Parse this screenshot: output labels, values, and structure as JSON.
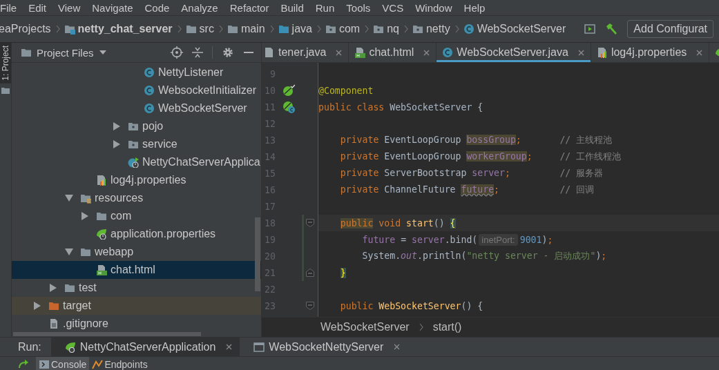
{
  "menu": [
    "File",
    "Edit",
    "View",
    "Navigate",
    "Code",
    "Analyze",
    "Refactor",
    "Build",
    "Run",
    "Tools",
    "VCS",
    "Window",
    "Help"
  ],
  "navbar": {
    "crumbs": [
      {
        "label": "eaProjects",
        "kind": "plain"
      },
      {
        "label": "netty_chat_server",
        "kind": "module"
      },
      {
        "label": "src",
        "kind": "folder"
      },
      {
        "label": "main",
        "kind": "folder"
      },
      {
        "label": "java",
        "kind": "source-folder"
      },
      {
        "label": "com",
        "kind": "package"
      },
      {
        "label": "nq",
        "kind": "package"
      },
      {
        "label": "netty",
        "kind": "package"
      },
      {
        "label": "WebSocketServer",
        "kind": "class"
      }
    ],
    "config_button": "Add Configurat"
  },
  "side_strip": {
    "label": "1: Project",
    "selected": true
  },
  "project": {
    "title": "Project Files",
    "tree": [
      {
        "children": [
          {
            "children": [
              {
                "children": [
                  {
                    "children": [
                      {
                        "children": [
                          {
                            "children": [
                              {
                                "label": "NettyListener",
                                "kind": "class",
                                "selected": false
                              },
                              {
                                "label": "WebsocketInitializer",
                                "kind": "class",
                                "selected": false
                              },
                              {
                                "label": "WebSocketServer",
                                "kind": "class",
                                "selected": false
                              }
                            ]
                          },
                          {
                            "label": "pojo",
                            "kind": "package",
                            "expanded": false,
                            "selected": false
                          },
                          {
                            "label": "service",
                            "kind": "package",
                            "expanded": false,
                            "selected": false
                          },
                          {
                            "label": "NettyChatServerApplica",
                            "kind": "spring-class",
                            "selected": false
                          }
                        ]
                      }
                    ]
                  },
                  {
                    "label": "log4j.properties",
                    "kind": "properties",
                    "selected": false
                  }
                ]
              },
              {
                "label": "resources",
                "kind": "resources-folder",
                "expanded": true,
                "selected": false,
                "children": [
                  {
                    "label": "com",
                    "kind": "folder",
                    "expanded": false,
                    "selected": false
                  },
                  {
                    "label": "application.properties",
                    "kind": "spring-properties",
                    "selected": false
                  }
                ]
              },
              {
                "label": "webapp",
                "kind": "folder",
                "expanded": true,
                "selected": false,
                "children": [
                  {
                    "label": "chat.html",
                    "kind": "html",
                    "selected": true
                  }
                ]
              }
            ]
          },
          {
            "label": "test",
            "kind": "folder",
            "expanded": false,
            "selected": false
          }
        ]
      },
      {
        "label": "target",
        "kind": "excluded-folder",
        "expanded": false,
        "selected": false
      },
      {
        "label": ".gitignore",
        "kind": "file",
        "selected": false
      }
    ]
  },
  "editor": {
    "tabs": [
      {
        "label": "tener.java",
        "kind": "java",
        "selected": false
      },
      {
        "label": "chat.html",
        "kind": "html",
        "selected": false
      },
      {
        "label": "WebSocketServer.java",
        "kind": "class",
        "selected": true
      },
      {
        "label": "log4j.properties",
        "kind": "properties",
        "selected": false
      },
      {
        "kind": "spring",
        "selected": false
      }
    ],
    "lines": [
      {
        "number": "9",
        "current": false,
        "changed": false
      },
      {
        "number": "10",
        "current": false,
        "changed": false,
        "markers": [
          {
            "kind": "bean-check"
          }
        ],
        "tokens": [
          {
            "kind": "annotation",
            "text": "@Component"
          }
        ]
      },
      {
        "number": "11",
        "current": false,
        "changed": false,
        "markers": [
          {
            "kind": "bean-class"
          }
        ],
        "tokens": [
          {
            "kind": "keyword",
            "text": "public class"
          },
          {
            "kind": "plain",
            "text": " WebSocketServer {"
          }
        ]
      },
      {
        "number": "12",
        "current": false,
        "changed": false
      },
      {
        "number": "13",
        "current": false,
        "changed": false,
        "tokens": [
          {
            "kind": "keyword",
            "text": "    private"
          },
          {
            "kind": "plain",
            "text": " EventLoopGroup "
          },
          {
            "kind": "field_marked",
            "text": "bossGroup"
          },
          {
            "kind": "keyword",
            "text": ";"
          },
          {
            "kind": "comment",
            "text": "       // 主线程池"
          }
        ]
      },
      {
        "number": "14",
        "current": false,
        "changed": false,
        "tokens": [
          {
            "kind": "keyword",
            "text": "    private"
          },
          {
            "kind": "plain",
            "text": " EventLoopGroup "
          },
          {
            "kind": "field_marked",
            "text": "workerGroup"
          },
          {
            "kind": "keyword",
            "text": ";"
          },
          {
            "kind": "comment",
            "text": "     // 工作线程池"
          }
        ]
      },
      {
        "number": "15",
        "current": false,
        "changed": false,
        "tokens": [
          {
            "kind": "keyword",
            "text": "    private"
          },
          {
            "kind": "plain",
            "text": " ServerBootstrap "
          },
          {
            "kind": "field",
            "text": "server"
          },
          {
            "kind": "keyword",
            "text": ";"
          },
          {
            "kind": "comment",
            "text": "         // 服务器"
          }
        ]
      },
      {
        "number": "16",
        "current": false,
        "changed": false,
        "tokens": [
          {
            "kind": "keyword",
            "text": "    private"
          },
          {
            "kind": "plain",
            "text": " ChannelFuture "
          },
          {
            "kind": "field_unused",
            "text": "future"
          },
          {
            "kind": "keyword",
            "text": ";"
          },
          {
            "kind": "comment",
            "text": "           // 回调"
          }
        ]
      },
      {
        "number": "17",
        "current": false,
        "changed": false
      },
      {
        "number": "18",
        "current": true,
        "changed": true,
        "markers": [
          {
            "kind": "fold-start"
          }
        ],
        "tokens": [
          {
            "kind": "keyword_marked",
            "text": "    public"
          },
          {
            "kind": "keyword",
            "text": " void"
          },
          {
            "kind": "method",
            "text": " start"
          },
          {
            "kind": "plain",
            "text": "() "
          },
          {
            "kind": "brace_match",
            "text": "{"
          }
        ]
      },
      {
        "number": "19",
        "current": false,
        "changed": true,
        "tokens": [
          {
            "kind": "field",
            "text": "        future"
          },
          {
            "kind": "plain",
            "text": " = "
          },
          {
            "kind": "field",
            "text": "server"
          },
          {
            "kind": "plain",
            "text": ".bind("
          },
          {
            "kind": "hint",
            "text": "inetPort:"
          },
          {
            "kind": "number",
            "text": "9001"
          },
          {
            "kind": "plain",
            "text": ")"
          },
          {
            "kind": "keyword",
            "text": ";"
          }
        ]
      },
      {
        "number": "20",
        "current": false,
        "changed": true,
        "tokens": [
          {
            "kind": "plain",
            "text": "        System."
          },
          {
            "kind": "static",
            "text": "out"
          },
          {
            "kind": "plain",
            "text": ".println("
          },
          {
            "kind": "string",
            "text": "\"netty server - 启动成功\""
          },
          {
            "kind": "plain",
            "text": ")"
          },
          {
            "kind": "keyword",
            "text": ";"
          }
        ]
      },
      {
        "number": "21",
        "current": false,
        "changed": true,
        "markers": [
          {
            "kind": "fold-end"
          }
        ],
        "tokens": [
          {
            "kind": "brace_match",
            "text": "    }"
          }
        ]
      },
      {
        "number": "22",
        "current": false,
        "changed": false
      },
      {
        "number": "23",
        "current": false,
        "changed": false,
        "markers": [
          {
            "kind": "fold-start"
          }
        ],
        "tokens": [
          {
            "kind": "keyword",
            "text": "    public"
          },
          {
            "kind": "method",
            "text": " WebSocketServer"
          },
          {
            "kind": "plain",
            "text": "() {"
          }
        ]
      }
    ],
    "breadcrumb": [
      "WebSocketServer",
      "start()"
    ]
  },
  "run_bar": {
    "label": "Run:",
    "tabs": [
      {
        "label": "NettyChatServerApplication",
        "kind": "spring",
        "selected": true
      },
      {
        "label": "WebSocketNettyServer",
        "kind": "window",
        "selected": false
      }
    ]
  },
  "run_tools": {
    "tabs": [
      {
        "label": "Console",
        "kind": "console",
        "selected": true
      },
      {
        "label": "Endpoints",
        "kind": "endpoints",
        "selected": false
      }
    ]
  }
}
